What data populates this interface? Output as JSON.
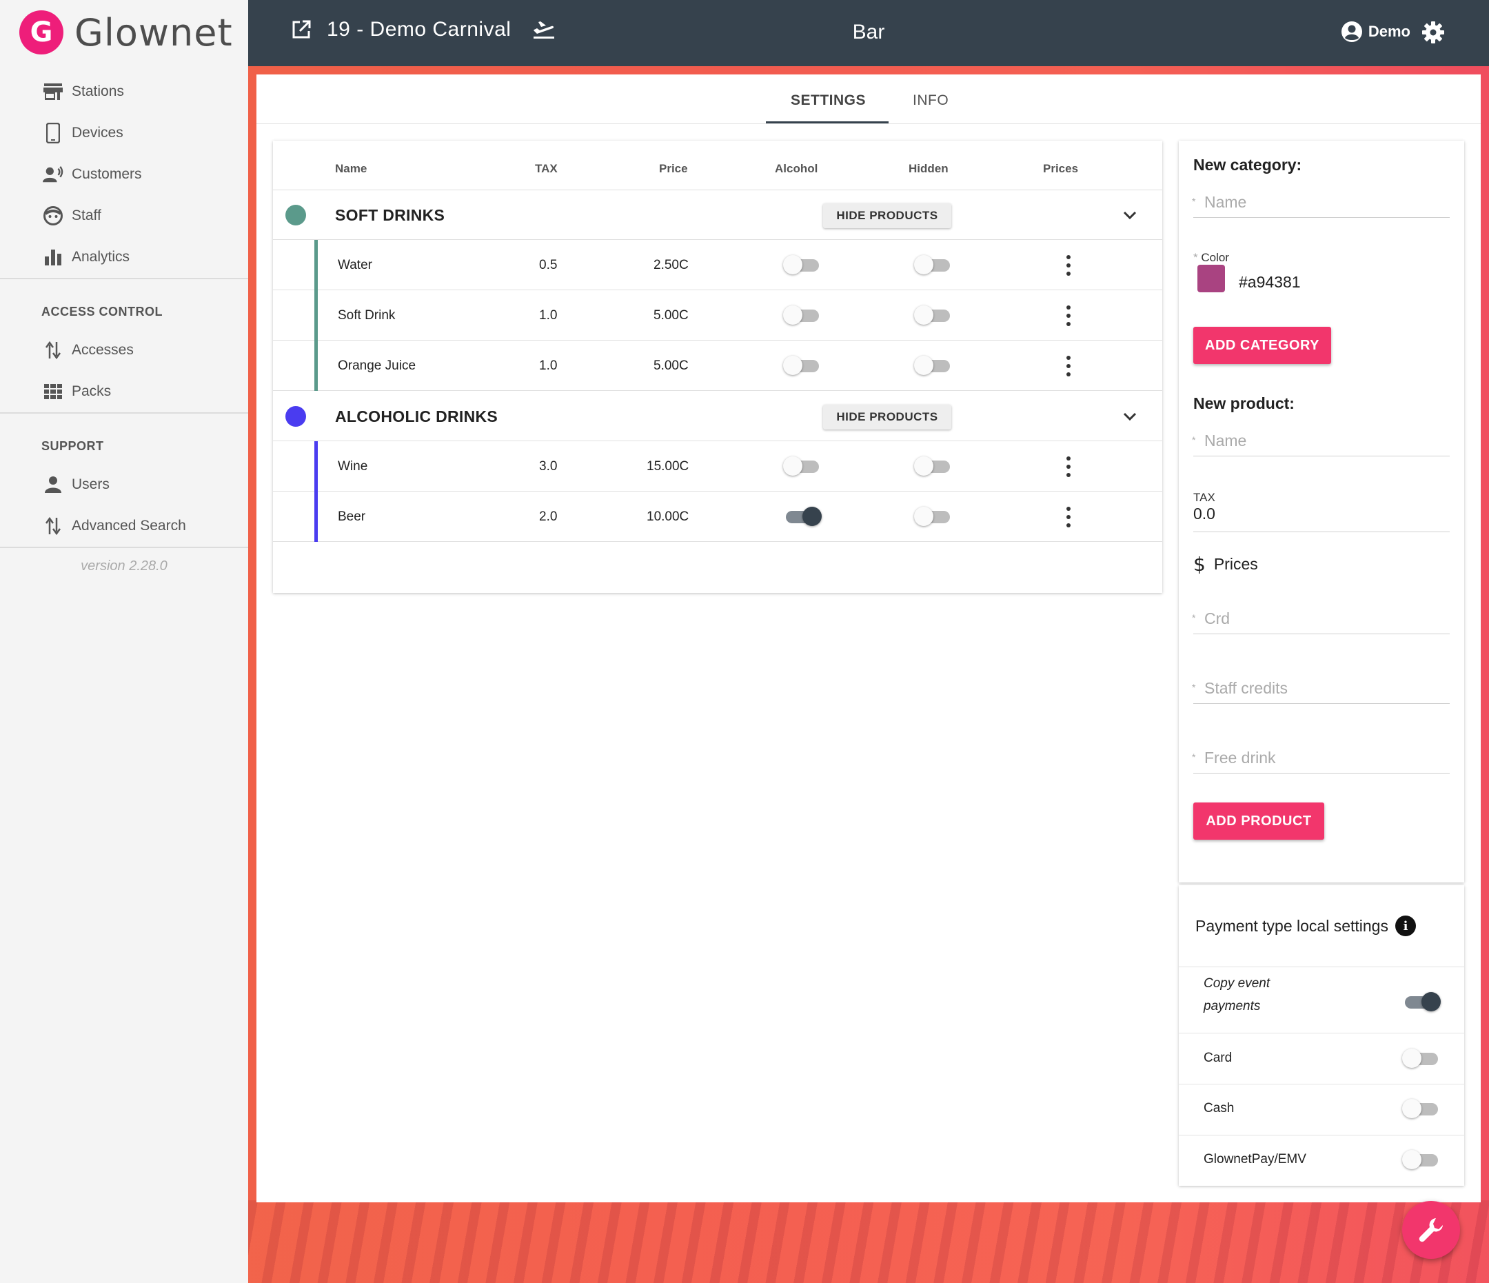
{
  "brand": {
    "name": "Glownet",
    "mark": "G",
    "color": "#ee1e7a"
  },
  "sidebar": {
    "items": [
      {
        "label": "Stations",
        "icon": "store-icon"
      },
      {
        "label": "Devices",
        "icon": "phone-icon"
      },
      {
        "label": "Customers",
        "icon": "customers-icon"
      },
      {
        "label": "Staff",
        "icon": "face-icon"
      },
      {
        "label": "Analytics",
        "icon": "bar-chart-icon"
      }
    ],
    "access_control": {
      "title": "ACCESS CONTROL",
      "items": [
        {
          "label": "Accesses",
          "icon": "swap-vert-icon"
        },
        {
          "label": "Packs",
          "icon": "grid-icon"
        }
      ]
    },
    "support": {
      "title": "SUPPORT",
      "items": [
        {
          "label": "Users",
          "icon": "person-icon"
        },
        {
          "label": "Advanced Search",
          "icon": "swap-vert-icon"
        }
      ]
    },
    "version": "version 2.28.0"
  },
  "topbar": {
    "event_name": "19 - Demo Carnival",
    "station_name": "Bar",
    "user_name": "Demo",
    "background": "#36424d"
  },
  "tabs": [
    {
      "label": "SETTINGS",
      "active": true
    },
    {
      "label": "INFO",
      "active": false
    }
  ],
  "table": {
    "headers": {
      "name": "Name",
      "tax": "TAX",
      "price": "Price",
      "alcohol": "Alcohol",
      "hidden": "Hidden",
      "prices": "Prices"
    },
    "hide_products_label": "HIDE PRODUCTS",
    "categories": [
      {
        "name": "SOFT DRINKS",
        "color": "#5b9a8b",
        "products": [
          {
            "name": "Water",
            "tax": "0.5",
            "price": "2.50C",
            "alcohol": false,
            "hidden": false
          },
          {
            "name": "Soft Drink",
            "tax": "1.0",
            "price": "5.00C",
            "alcohol": false,
            "hidden": false
          },
          {
            "name": "Orange Juice",
            "tax": "1.0",
            "price": "5.00C",
            "alcohol": false,
            "hidden": false
          }
        ]
      },
      {
        "name": "ALCOHOLIC DRINKS",
        "color": "#4a3cf0",
        "products": [
          {
            "name": "Wine",
            "tax": "3.0",
            "price": "15.00C",
            "alcohol": false,
            "hidden": false
          },
          {
            "name": "Beer",
            "tax": "2.0",
            "price": "10.00C",
            "alcohol": true,
            "hidden": false
          }
        ]
      }
    ]
  },
  "new_category": {
    "title": "New category:",
    "name_placeholder": "Name",
    "color_label": "Color",
    "color_value": "#a94381",
    "button": "ADD CATEGORY"
  },
  "new_product": {
    "title": "New product:",
    "name_placeholder": "Name",
    "tax_label": "TAX",
    "tax_value": "0.0",
    "prices_label": "Prices",
    "crd_placeholder": "Crd",
    "staff_credits_placeholder": "Staff credits",
    "free_drink_placeholder": "Free drink",
    "button": "ADD PRODUCT"
  },
  "payment_settings": {
    "title": "Payment type local settings",
    "rows": [
      {
        "label": "Copy event payments",
        "enabled": true
      },
      {
        "label": "Card",
        "enabled": false
      },
      {
        "label": "Cash",
        "enabled": false
      },
      {
        "label": "GlownetPay/EMV",
        "enabled": false
      }
    ]
  },
  "accent": "#f2366c"
}
